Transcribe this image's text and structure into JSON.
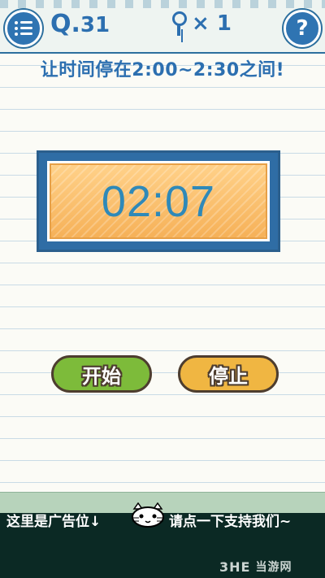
{
  "header": {
    "level_prefix": "Q.",
    "level_number": "31",
    "key_count_text": "× 1",
    "menu_icon": "menu-icon",
    "help_icon": "question-icon",
    "help_glyph": "?",
    "key_icon": "key-icon"
  },
  "instruction": "让时间停在2:00~2:30之间!",
  "timer": {
    "display": "02:07"
  },
  "buttons": {
    "start_label": "开始",
    "stop_label": "停止"
  },
  "ad": {
    "left_text": "这里是广告位↓",
    "right_text": "请点一下支持我们~",
    "mascot_icon": "cat-mascot-icon"
  },
  "watermark": {
    "brand": "3HE",
    "text": "当游网"
  },
  "colors": {
    "accent_blue": "#2c6fb0",
    "timer_orange": "#f6b158",
    "start_green": "#7dbb3a",
    "stop_yellow": "#f0b642",
    "ad_background": "#0b2924"
  }
}
